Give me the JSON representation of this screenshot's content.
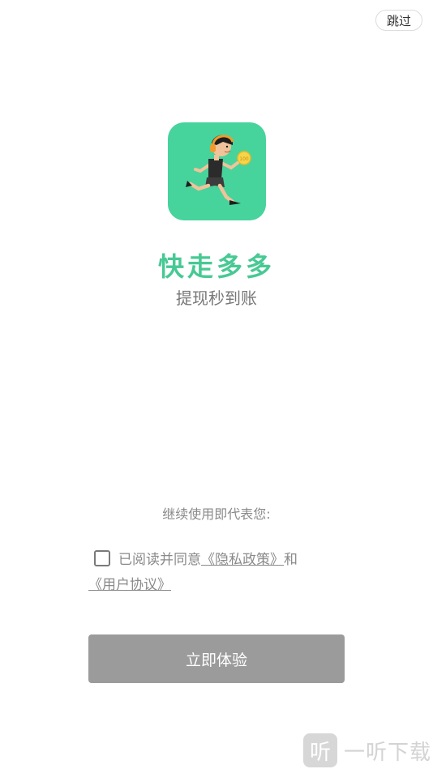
{
  "header": {
    "skip_label": "跳过"
  },
  "app": {
    "name": "快走多多",
    "slogan": "提现秒到账",
    "icon": "running-man-icon",
    "brand_color": "#47d39c",
    "coin_text": "100"
  },
  "agreement": {
    "notice": "继续使用即代表您:",
    "prefix": "已阅读并同意",
    "privacy_link": "《隐私政策》",
    "conjunction": "和",
    "terms_link": "《用户协议》",
    "checked": false
  },
  "action": {
    "start_label": "立即体验",
    "button_color": "#9b9b9b"
  },
  "watermark": {
    "logo_glyph": "听",
    "text": "一听下载"
  }
}
